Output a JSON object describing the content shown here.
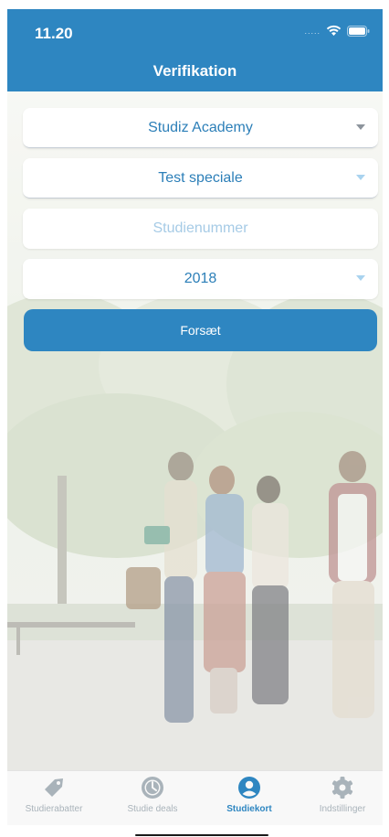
{
  "status_bar": {
    "time": "11.20",
    "signal": "....."
  },
  "header": {
    "title": "Verifikation"
  },
  "form": {
    "institution": "Studiz Academy",
    "specialty": "Test speciale",
    "student_number_placeholder": "Studienummer",
    "year": "2018",
    "continue_label": "Forsæt"
  },
  "tabbar": {
    "items": [
      {
        "label": "Studierabatter",
        "icon": "tag-icon",
        "active": false
      },
      {
        "label": "Studie deals",
        "icon": "clock-icon",
        "active": false
      },
      {
        "label": "Studiekort",
        "icon": "user-icon",
        "active": true
      },
      {
        "label": "Indstillinger",
        "icon": "gear-icon",
        "active": false
      }
    ]
  },
  "colors": {
    "primary": "#2e86c1",
    "inactive_tab": "#a9b3ba",
    "field_text": "#2c7fb8"
  }
}
